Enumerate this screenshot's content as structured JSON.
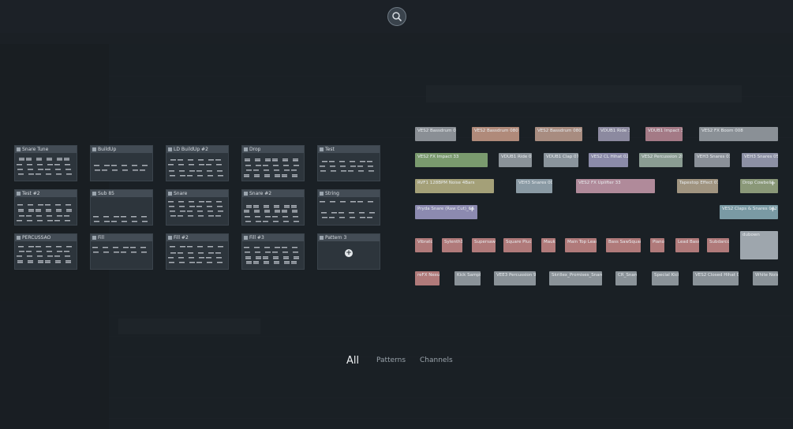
{
  "filter_tabs": {
    "all": "All",
    "patterns": "Patterns",
    "channels": "Channels"
  },
  "patterns": [
    "Snare Tune",
    "BuildUp",
    "LD BuildUp #2",
    "Drop",
    "Test",
    "Test #2",
    "Sub 85",
    "Snare",
    "Snare #2",
    "String",
    "PERCUSSÃO",
    "Fill",
    "Fill #2",
    "Fill #3",
    "Pattern 3"
  ],
  "channels": [
    {
      "label": "VES2 Bassdrum 080",
      "color": "#8a8f95"
    },
    {
      "label": "VES2 Bassdrum 080 #1",
      "color": "#b08a7a"
    },
    {
      "label": "VES2 Bassdrum 080 #2",
      "color": "#a88c80"
    },
    {
      "label": "VDUB1 Ride 31",
      "color": "#8c8aa0"
    },
    {
      "label": "VDUB1 Impact 38",
      "color": "#a47a86"
    },
    {
      "label": "VES2 FX Boom 008",
      "color": "#8a9096"
    },
    {
      "label": "VES2 FX Impact 33",
      "color": "#7a9a6e"
    },
    {
      "label": "VDUB1 Ride 01",
      "color": "#8a9298"
    },
    {
      "label": "VDUB1 Clap 075",
      "color": "#8a949c"
    },
    {
      "label": "VES2 CL Hihat 020",
      "color": "#8a8aa8"
    },
    {
      "label": "VES2 Percussion 207",
      "color": "#8a9c92"
    },
    {
      "label": "VEH3 Snares 035",
      "color": "#8a9098"
    },
    {
      "label": "VEH3 Snares 056",
      "color": "#8c90a4"
    },
    {
      "label": "RVF1 128BPM Noise 4Bars",
      "color": "#a4a078"
    },
    {
      "label": "VEH3 Snares 007",
      "color": "#8a9aa4"
    },
    {
      "label": "VES2 FX Uplifter 33",
      "color": "#b08a9a"
    },
    {
      "label": "Tapestop Effect 07",
      "color": "#a09480"
    },
    {
      "label": "Drop Cowbell",
      "color": "#8a9878"
    },
    {
      "label": "Pryda Snare (Raw Cut)_64",
      "color": "#8c8ab0"
    },
    {
      "label": "VES2 Claps & Snares 042",
      "color": "#7a9aa4"
    },
    {
      "label": "Vibrato",
      "color": "#b07a7a"
    },
    {
      "label": "Sylenth1",
      "color": "#b07a7a"
    },
    {
      "label": "Supersaw",
      "color": "#b07a7a"
    },
    {
      "label": "Square Pluck",
      "color": "#b07a7a"
    },
    {
      "label": "Mauk",
      "color": "#b07a7a"
    },
    {
      "label": "Main Top Lead",
      "color": "#b07a7a"
    },
    {
      "label": "Bass SawSquare",
      "color": "#b07a7a"
    },
    {
      "label": "Piano",
      "color": "#b07a7a"
    },
    {
      "label": "Lead Bass",
      "color": "#b07a7a"
    },
    {
      "label": "Subdarco",
      "color": "#b07a7a"
    },
    {
      "label": "dubown",
      "color": "#9ea6ad"
    },
    {
      "label": "reFX Nexus",
      "color": "#b07a7a"
    },
    {
      "label": "Kick Sample",
      "color": "#8a9298"
    },
    {
      "label": "VEE3 Percussion 98",
      "color": "#8a9298"
    },
    {
      "label": "Skrillex_Promises_Snare",
      "color": "#8a9298"
    },
    {
      "label": "CR_Snare",
      "color": "#8a9298"
    },
    {
      "label": "Special Kick",
      "color": "#8a9298"
    },
    {
      "label": "VES2 Closed Hihat 037",
      "color": "#8a9298"
    },
    {
      "label": "White Noise",
      "color": "#8a9298"
    }
  ]
}
